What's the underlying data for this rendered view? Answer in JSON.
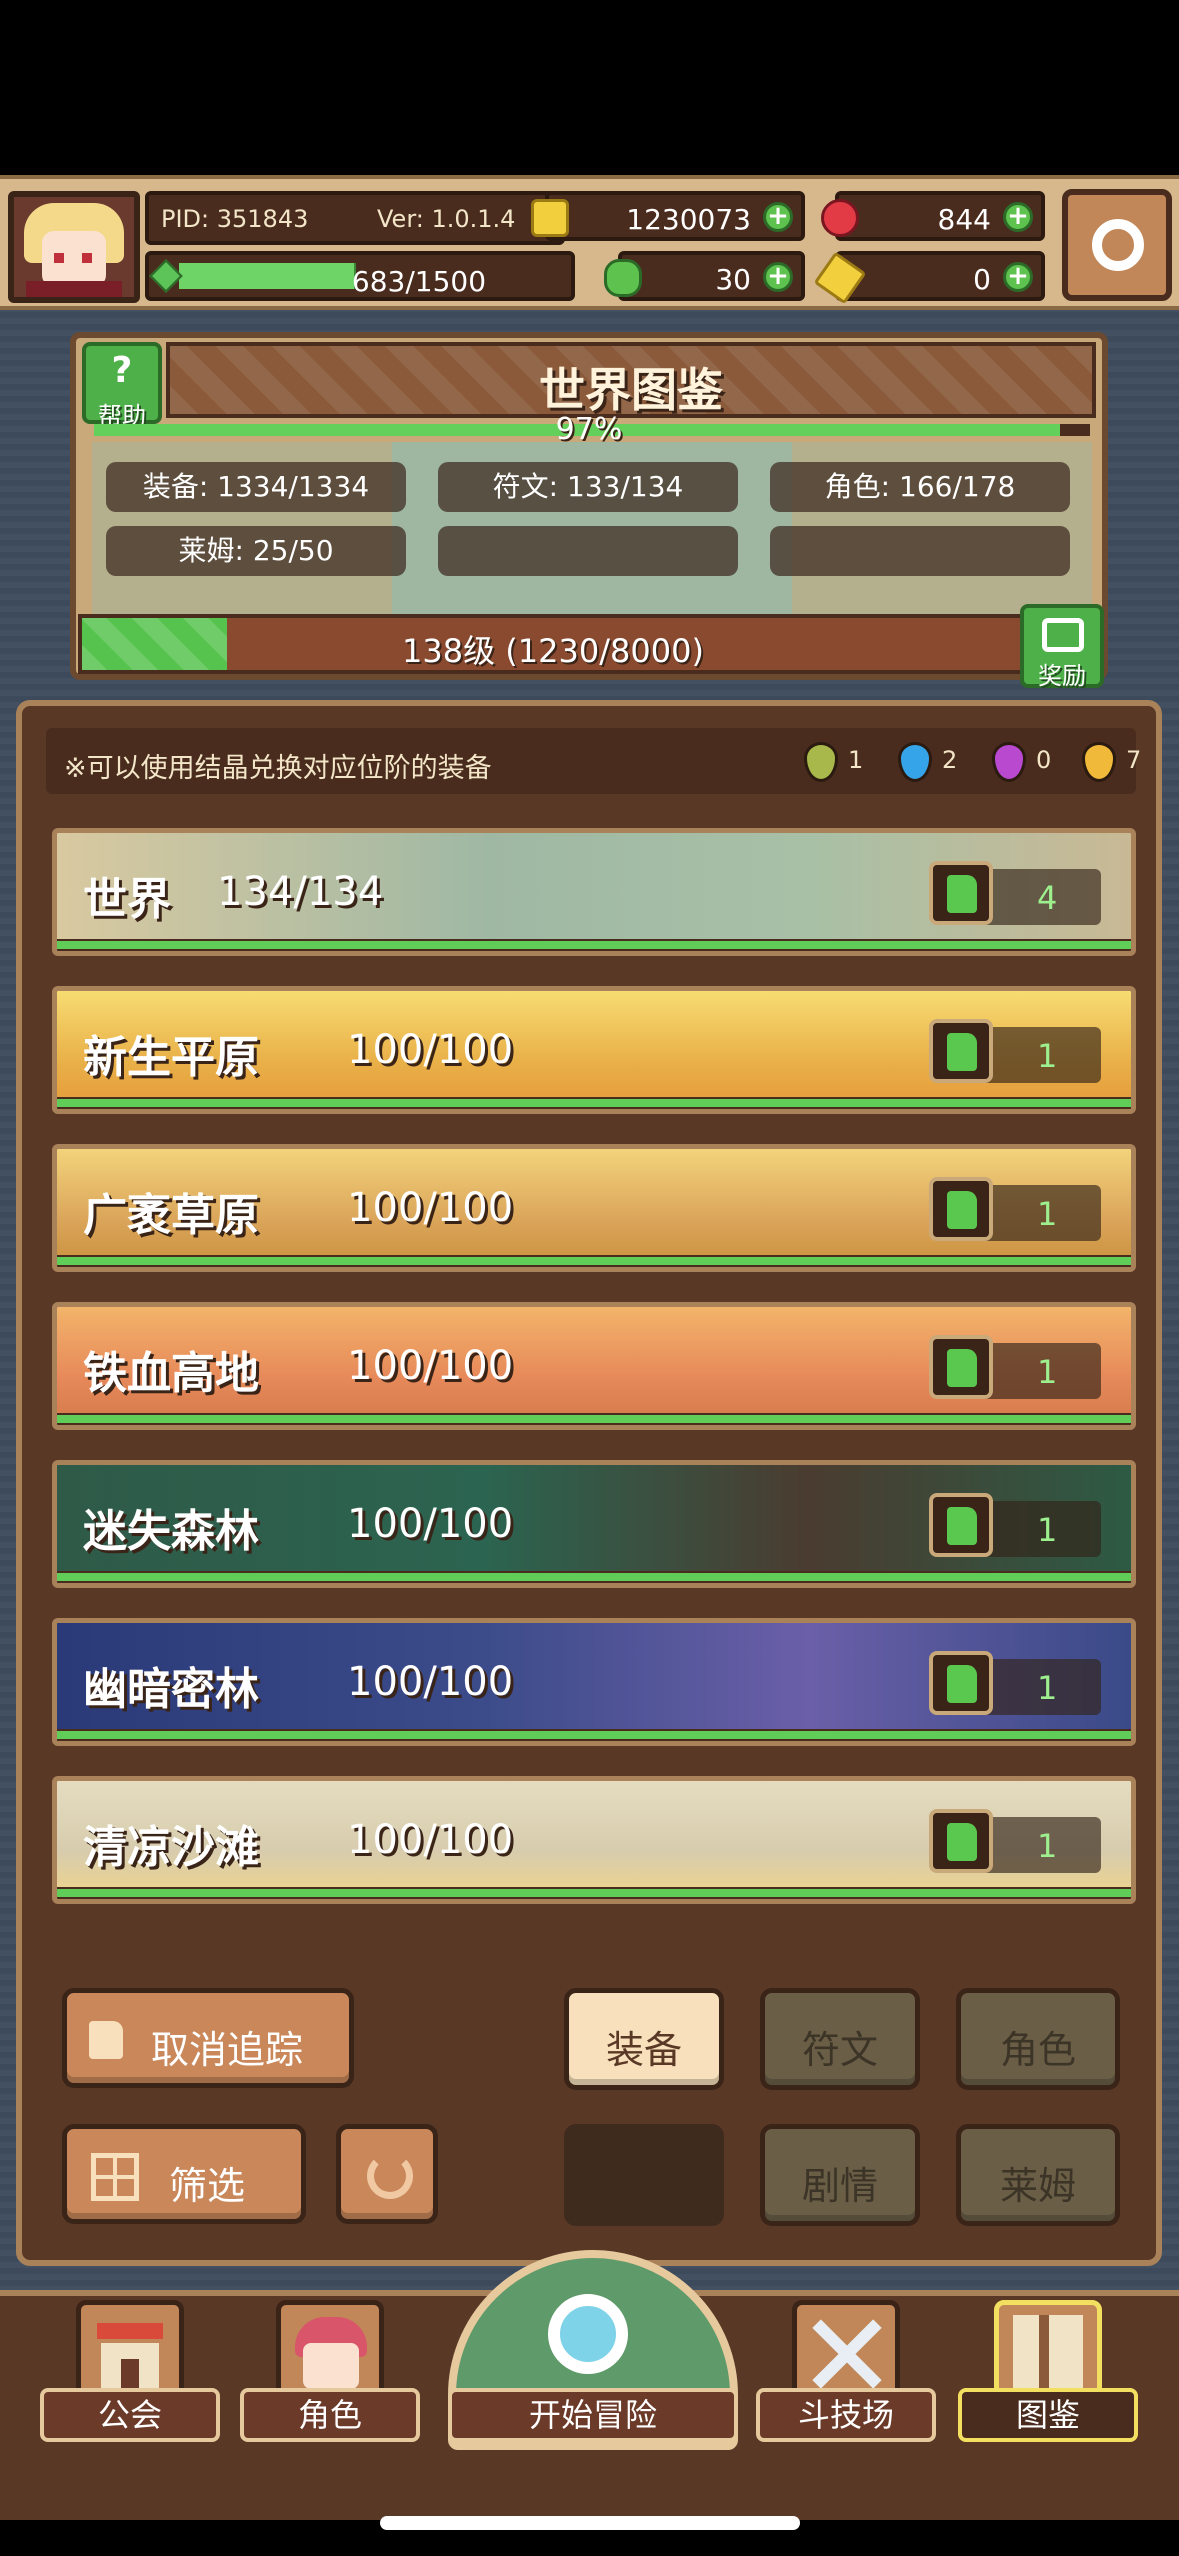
{
  "header": {
    "pid": "PID: 351843",
    "version": "Ver: 1.0.1.4",
    "exp": "683/1500",
    "exp_fraction": 0.455,
    "coins": "1230073",
    "rubies": "844",
    "clovers": "30",
    "keys": "0"
  },
  "world": {
    "help_label": "帮助",
    "title": "世界图鉴",
    "percent": "97%",
    "percent_value": 0.97,
    "stats": {
      "equipment": "装备: 1334/1334",
      "runes": "符文: 133/134",
      "characters": "角色: 166/178",
      "slime": "莱姆: 25/50"
    },
    "level": "138级 (1230/8000)",
    "level_fraction": 0.154,
    "reward_label": "奖励"
  },
  "notice": {
    "text": "※可以使用结晶兑换对应位阶的装备",
    "crystals": [
      {
        "color": "#a9b84a",
        "count": "1"
      },
      {
        "color": "#35a4e8",
        "count": "2"
      },
      {
        "color": "#b94ad0",
        "count": "0"
      },
      {
        "color": "#f0b93a",
        "count": "7"
      }
    ]
  },
  "regions": [
    {
      "name": "世界",
      "count": "134/134",
      "likes": "4"
    },
    {
      "name": "新生平原",
      "count": "100/100",
      "likes": "1"
    },
    {
      "name": "广袤草原",
      "count": "100/100",
      "likes": "1"
    },
    {
      "name": "铁血高地",
      "count": "100/100",
      "likes": "1"
    },
    {
      "name": "迷失森林",
      "count": "100/100",
      "likes": "1"
    },
    {
      "name": "幽暗密林",
      "count": "100/100",
      "likes": "1"
    },
    {
      "name": "清凉沙滩",
      "count": "100/100",
      "likes": "1"
    }
  ],
  "controls": {
    "untrack": "取消追踪",
    "filter": "筛选",
    "tabs": {
      "equipment": "装备",
      "runes": "符文",
      "characters": "角色",
      "story": "剧情",
      "slime": "莱姆"
    }
  },
  "nav": {
    "guild": "公会",
    "character": "角色",
    "adventure": "开始冒险",
    "arena": "斗技场",
    "codex": "图鉴"
  },
  "colors": {
    "progress_green": "#61cd59",
    "panel_brown": "#5a3826",
    "border_tan": "#a9825a",
    "active_highlight": "#f3e060"
  }
}
